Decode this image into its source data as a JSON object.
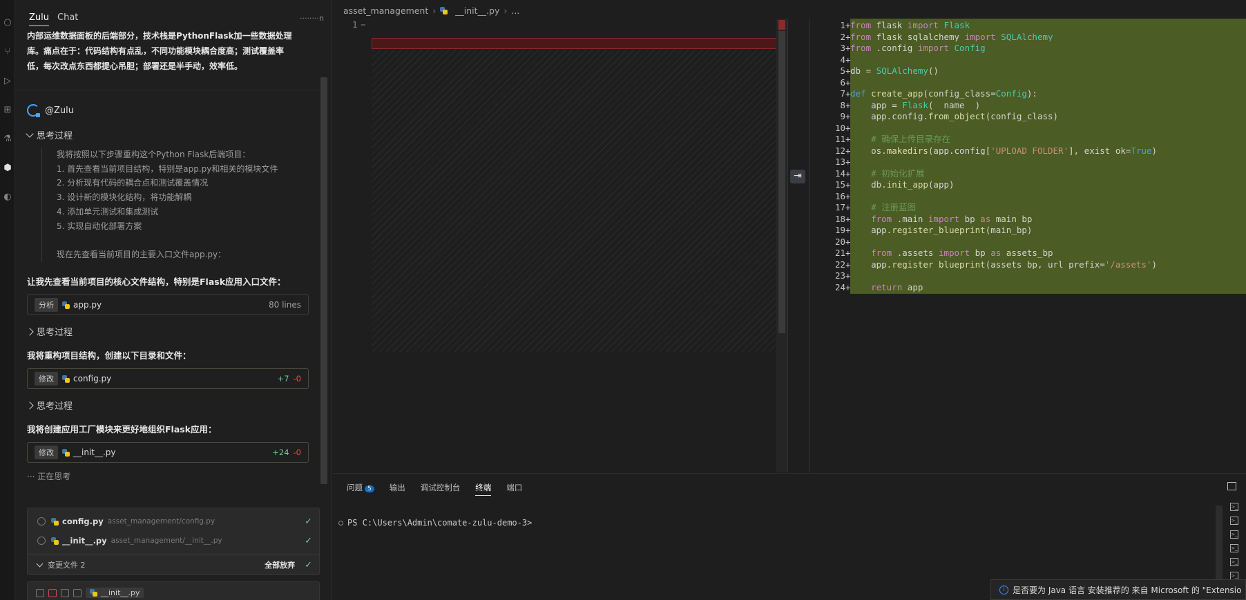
{
  "chat": {
    "tabs": [
      "Zulu",
      "Chat"
    ],
    "user": "········n",
    "intro_lines": [
      "内部运维数据面板的后端部分，技术栈是PythonFlask加一些数据处理",
      "库。痛点在于：代码结构有点乱，不同功能模块耦合度高；测试覆盖率",
      "低，每次改点东西都提心吊胆；部署还是半手动，效率低。"
    ],
    "agent_name": "@Zulu",
    "think_label": "思考过程",
    "think_lines": [
      "我将按照以下步骤重构这个Python Flask后端项目：",
      "1. 首先查看当前项目结构，特别是app.py和相关的模块文件",
      "2. 分析现有代码的耦合点和测试覆盖情况",
      "3. 设计新的模块化结构，将功能解耦",
      "4. 添加单元测试和集成测试",
      "5. 实现自动化部署方案",
      "",
      "现在先查看当前项目的主要入口文件app.py："
    ],
    "step1_text": "让我先查看当前项目的核心文件结构，特别是Flask应用入口文件：",
    "card1": {
      "tag": "分析",
      "file": "app.py",
      "lines": "80 lines"
    },
    "step2_text": "我将重构项目结构，创建以下目录和文件：",
    "card2": {
      "tag": "修改",
      "file": "config.py",
      "add": "+7",
      "del": "-0"
    },
    "step3_text": "我将创建应用工厂模块来更好地组织Flask应用：",
    "card3": {
      "tag": "修改",
      "file": "__init__.py",
      "add": "+24",
      "del": "-0"
    },
    "thinking_now": "··· 正在思考",
    "changes": {
      "files": [
        {
          "name": "config.py",
          "path": "asset_management/config.py"
        },
        {
          "name": "__init__.py",
          "path": "asset_management/__init__.py"
        }
      ],
      "footer_label": "变更文件 2",
      "discard_all": "全部放弃"
    },
    "input_context": "__init__.py"
  },
  "editor": {
    "breadcrumb": [
      "asset_management",
      "__init__.py",
      "..."
    ],
    "left_line": "1",
    "left_marker": "−",
    "code": [
      "from flask import Flask",
      "from flask_sqlalchemy import SQLAlchemy",
      "from .config import Config",
      "",
      "db = SQLAlchemy()",
      "",
      "def create_app(config_class=Config):",
      "    app = Flask(__name__)",
      "    app.config.from_object(config_class)",
      "",
      "    # 确保上传目录存在",
      "    os.makedirs(app.config['UPLOAD_FOLDER'], exist_ok=True)",
      "",
      "    # 初始化扩展",
      "    db.init_app(app)",
      "",
      "    # 注册蓝图",
      "    from .main import bp as main_bp",
      "    app.register_blueprint(main_bp)",
      "",
      "    from .assets import bp as assets_bp",
      "    app.register_blueprint(assets_bp, url_prefix='/assets')",
      "",
      "    return app"
    ]
  },
  "panel": {
    "tabs": [
      "问题",
      "输出",
      "调试控制台",
      "终端",
      "端口"
    ],
    "problems_count": "5",
    "active_tab": "终端",
    "terminal_prompt": "PS C:\\Users\\Admin\\comate-zulu-demo-3>"
  },
  "notification": "是否要为 Java 语言 安装推荐的 来自 Microsoft 的 \"Extensio"
}
